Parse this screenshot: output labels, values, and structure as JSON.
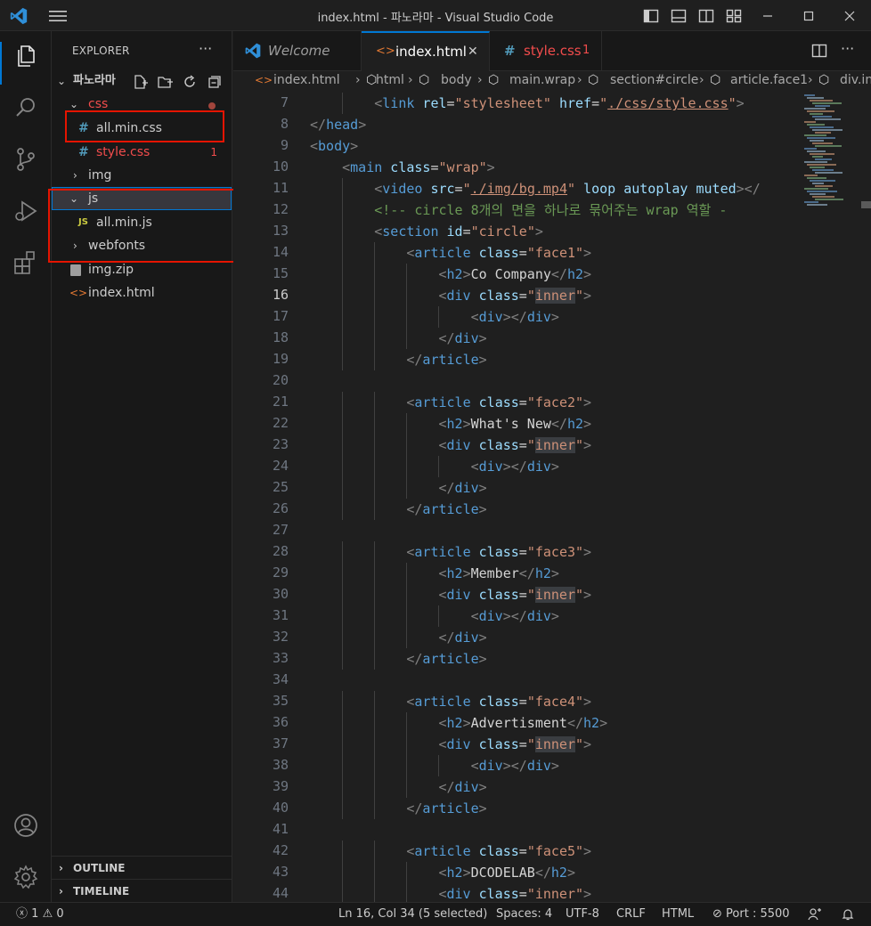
{
  "window": {
    "title": "index.html - 파노라마 - Visual Studio Code"
  },
  "explorer": {
    "header": "EXPLORER",
    "more": "···",
    "folder_name": "파노라마",
    "items": [
      {
        "label": "css",
        "type": "folder",
        "expanded": true,
        "color": "#f14c4c"
      },
      {
        "label": "all.min.css",
        "type": "css"
      },
      {
        "label": "style.css",
        "type": "css",
        "badge": "1",
        "color": "#f14c4c"
      },
      {
        "label": "img",
        "type": "folder",
        "expanded": false
      },
      {
        "label": "js",
        "type": "folder",
        "expanded": true
      },
      {
        "label": "all.min.js",
        "type": "js"
      },
      {
        "label": "webfonts",
        "type": "folder",
        "expanded": false
      },
      {
        "label": "img.zip",
        "type": "zip"
      },
      {
        "label": "index.html",
        "type": "html"
      }
    ],
    "outline": "OUTLINE",
    "timeline": "TIMELINE"
  },
  "tabs": [
    {
      "label": "Welcome",
      "italic": true
    },
    {
      "label": "index.html",
      "active": true,
      "close": "✕"
    },
    {
      "label": "style.css",
      "badge": "1",
      "color": "#f14c4c"
    }
  ],
  "breadcrumb": [
    "index.html",
    "html",
    "body",
    "main.wrap",
    "section#circle",
    "article.face1",
    "div.in"
  ],
  "editor": {
    "first_line": 7,
    "current_line": 16,
    "lines": [
      [
        [
          8,
          "<",
          "tagp"
        ],
        [
          0,
          "link",
          "tn"
        ],
        [
          0,
          " ",
          "tx"
        ],
        [
          0,
          "rel",
          "an"
        ],
        [
          0,
          "=",
          "tx"
        ],
        [
          0,
          "\"stylesheet\"",
          "av"
        ],
        [
          0,
          " ",
          "tx"
        ],
        [
          0,
          "href",
          "an"
        ],
        [
          0,
          "=",
          "tx"
        ],
        [
          0,
          "\"",
          "av"
        ],
        [
          0,
          "./css/style.css",
          "avu"
        ],
        [
          0,
          "\"",
          "av"
        ],
        [
          0,
          ">",
          "tagp"
        ]
      ],
      [
        [
          0,
          "</",
          "tagp"
        ],
        [
          0,
          "head",
          "tn"
        ],
        [
          0,
          ">",
          "tagp"
        ]
      ],
      [
        [
          0,
          "<",
          "tagp"
        ],
        [
          0,
          "body",
          "tn"
        ],
        [
          0,
          ">",
          "tagp"
        ]
      ],
      [
        [
          4,
          "<",
          "tagp"
        ],
        [
          0,
          "main",
          "tn"
        ],
        [
          0,
          " ",
          "tx"
        ],
        [
          0,
          "class",
          "an"
        ],
        [
          0,
          "=",
          "tx"
        ],
        [
          0,
          "\"wrap\"",
          "av"
        ],
        [
          0,
          ">",
          "tagp"
        ]
      ],
      [
        [
          8,
          "<",
          "tagp"
        ],
        [
          0,
          "video",
          "tn"
        ],
        [
          0,
          " ",
          "tx"
        ],
        [
          0,
          "src",
          "an"
        ],
        [
          0,
          "=",
          "tx"
        ],
        [
          0,
          "\"",
          "av"
        ],
        [
          0,
          "./img/bg.mp4",
          "avu"
        ],
        [
          0,
          "\"",
          "av"
        ],
        [
          0,
          " ",
          "tx"
        ],
        [
          0,
          "loop",
          "an"
        ],
        [
          0,
          " ",
          "tx"
        ],
        [
          0,
          "autoplay",
          "an"
        ],
        [
          0,
          " ",
          "tx"
        ],
        [
          0,
          "muted",
          "an"
        ],
        [
          0,
          "></",
          "tagp"
        ]
      ],
      [
        [
          8,
          "<!-- circle 8개의 면을 하나로 묶어주는 wrap 역할 -",
          "cm"
        ]
      ],
      [
        [
          8,
          "<",
          "tagp"
        ],
        [
          0,
          "section",
          "tn"
        ],
        [
          0,
          " ",
          "tx"
        ],
        [
          0,
          "id",
          "an"
        ],
        [
          0,
          "=",
          "tx"
        ],
        [
          0,
          "\"circle\"",
          "av"
        ],
        [
          0,
          ">",
          "tagp"
        ]
      ],
      [
        [
          12,
          "<",
          "tagp"
        ],
        [
          0,
          "article",
          "tn"
        ],
        [
          0,
          " ",
          "tx"
        ],
        [
          0,
          "class",
          "an"
        ],
        [
          0,
          "=",
          "tx"
        ],
        [
          0,
          "\"face1\"",
          "av"
        ],
        [
          0,
          ">",
          "tagp"
        ]
      ],
      [
        [
          16,
          "<",
          "tagp"
        ],
        [
          0,
          "h2",
          "tn"
        ],
        [
          0,
          ">",
          "tagp"
        ],
        [
          0,
          "Co Company",
          "tx"
        ],
        [
          0,
          "</",
          "tagp"
        ],
        [
          0,
          "h2",
          "tn"
        ],
        [
          0,
          ">",
          "tagp"
        ]
      ],
      [
        [
          16,
          "<",
          "tagp"
        ],
        [
          0,
          "div",
          "tn"
        ],
        [
          0,
          " ",
          "tx"
        ],
        [
          0,
          "class",
          "an"
        ],
        [
          0,
          "=",
          "tx"
        ],
        [
          0,
          "\"",
          "av"
        ],
        [
          0,
          "inner",
          "av hl"
        ],
        [
          0,
          "\"",
          "av"
        ],
        [
          0,
          ">",
          "tagp"
        ]
      ],
      [
        [
          20,
          "<",
          "tagp"
        ],
        [
          0,
          "div",
          "tn"
        ],
        [
          0,
          "></",
          "tagp"
        ],
        [
          0,
          "div",
          "tn"
        ],
        [
          0,
          ">",
          "tagp"
        ]
      ],
      [
        [
          16,
          "</",
          "tagp"
        ],
        [
          0,
          "div",
          "tn"
        ],
        [
          0,
          ">",
          "tagp"
        ]
      ],
      [
        [
          12,
          "</",
          "tagp"
        ],
        [
          0,
          "article",
          "tn"
        ],
        [
          0,
          ">",
          "tagp"
        ]
      ],
      [],
      [
        [
          12,
          "<",
          "tagp"
        ],
        [
          0,
          "article",
          "tn"
        ],
        [
          0,
          " ",
          "tx"
        ],
        [
          0,
          "class",
          "an"
        ],
        [
          0,
          "=",
          "tx"
        ],
        [
          0,
          "\"face2\"",
          "av"
        ],
        [
          0,
          ">",
          "tagp"
        ]
      ],
      [
        [
          16,
          "<",
          "tagp"
        ],
        [
          0,
          "h2",
          "tn"
        ],
        [
          0,
          ">",
          "tagp"
        ],
        [
          0,
          "What's New",
          "tx"
        ],
        [
          0,
          "</",
          "tagp"
        ],
        [
          0,
          "h2",
          "tn"
        ],
        [
          0,
          ">",
          "tagp"
        ]
      ],
      [
        [
          16,
          "<",
          "tagp"
        ],
        [
          0,
          "div",
          "tn"
        ],
        [
          0,
          " ",
          "tx"
        ],
        [
          0,
          "class",
          "an"
        ],
        [
          0,
          "=",
          "tx"
        ],
        [
          0,
          "\"",
          "av"
        ],
        [
          0,
          "inner",
          "av hl"
        ],
        [
          0,
          "\"",
          "av"
        ],
        [
          0,
          ">",
          "tagp"
        ]
      ],
      [
        [
          20,
          "<",
          "tagp"
        ],
        [
          0,
          "div",
          "tn"
        ],
        [
          0,
          "></",
          "tagp"
        ],
        [
          0,
          "div",
          "tn"
        ],
        [
          0,
          ">",
          "tagp"
        ]
      ],
      [
        [
          16,
          "</",
          "tagp"
        ],
        [
          0,
          "div",
          "tn"
        ],
        [
          0,
          ">",
          "tagp"
        ]
      ],
      [
        [
          12,
          "</",
          "tagp"
        ],
        [
          0,
          "article",
          "tn"
        ],
        [
          0,
          ">",
          "tagp"
        ]
      ],
      [],
      [
        [
          12,
          "<",
          "tagp"
        ],
        [
          0,
          "article",
          "tn"
        ],
        [
          0,
          " ",
          "tx"
        ],
        [
          0,
          "class",
          "an"
        ],
        [
          0,
          "=",
          "tx"
        ],
        [
          0,
          "\"face3\"",
          "av"
        ],
        [
          0,
          ">",
          "tagp"
        ]
      ],
      [
        [
          16,
          "<",
          "tagp"
        ],
        [
          0,
          "h2",
          "tn"
        ],
        [
          0,
          ">",
          "tagp"
        ],
        [
          0,
          "Member",
          "tx"
        ],
        [
          0,
          "</",
          "tagp"
        ],
        [
          0,
          "h2",
          "tn"
        ],
        [
          0,
          ">",
          "tagp"
        ]
      ],
      [
        [
          16,
          "<",
          "tagp"
        ],
        [
          0,
          "div",
          "tn"
        ],
        [
          0,
          " ",
          "tx"
        ],
        [
          0,
          "class",
          "an"
        ],
        [
          0,
          "=",
          "tx"
        ],
        [
          0,
          "\"",
          "av"
        ],
        [
          0,
          "inner",
          "av hl"
        ],
        [
          0,
          "\"",
          "av"
        ],
        [
          0,
          ">",
          "tagp"
        ]
      ],
      [
        [
          20,
          "<",
          "tagp"
        ],
        [
          0,
          "div",
          "tn"
        ],
        [
          0,
          "></",
          "tagp"
        ],
        [
          0,
          "div",
          "tn"
        ],
        [
          0,
          ">",
          "tagp"
        ]
      ],
      [
        [
          16,
          "</",
          "tagp"
        ],
        [
          0,
          "div",
          "tn"
        ],
        [
          0,
          ">",
          "tagp"
        ]
      ],
      [
        [
          12,
          "</",
          "tagp"
        ],
        [
          0,
          "article",
          "tn"
        ],
        [
          0,
          ">",
          "tagp"
        ]
      ],
      [],
      [
        [
          12,
          "<",
          "tagp"
        ],
        [
          0,
          "article",
          "tn"
        ],
        [
          0,
          " ",
          "tx"
        ],
        [
          0,
          "class",
          "an"
        ],
        [
          0,
          "=",
          "tx"
        ],
        [
          0,
          "\"face4\"",
          "av"
        ],
        [
          0,
          ">",
          "tagp"
        ]
      ],
      [
        [
          16,
          "<",
          "tagp"
        ],
        [
          0,
          "h2",
          "tn"
        ],
        [
          0,
          ">",
          "tagp"
        ],
        [
          0,
          "Advertisment",
          "tx"
        ],
        [
          0,
          "</",
          "tagp"
        ],
        [
          0,
          "h2",
          "tn"
        ],
        [
          0,
          ">",
          "tagp"
        ]
      ],
      [
        [
          16,
          "<",
          "tagp"
        ],
        [
          0,
          "div",
          "tn"
        ],
        [
          0,
          " ",
          "tx"
        ],
        [
          0,
          "class",
          "an"
        ],
        [
          0,
          "=",
          "tx"
        ],
        [
          0,
          "\"",
          "av"
        ],
        [
          0,
          "inner",
          "av hl"
        ],
        [
          0,
          "\"",
          "av"
        ],
        [
          0,
          ">",
          "tagp"
        ]
      ],
      [
        [
          20,
          "<",
          "tagp"
        ],
        [
          0,
          "div",
          "tn"
        ],
        [
          0,
          "></",
          "tagp"
        ],
        [
          0,
          "div",
          "tn"
        ],
        [
          0,
          ">",
          "tagp"
        ]
      ],
      [
        [
          16,
          "</",
          "tagp"
        ],
        [
          0,
          "div",
          "tn"
        ],
        [
          0,
          ">",
          "tagp"
        ]
      ],
      [
        [
          12,
          "</",
          "tagp"
        ],
        [
          0,
          "article",
          "tn"
        ],
        [
          0,
          ">",
          "tagp"
        ]
      ],
      [],
      [
        [
          12,
          "<",
          "tagp"
        ],
        [
          0,
          "article",
          "tn"
        ],
        [
          0,
          " ",
          "tx"
        ],
        [
          0,
          "class",
          "an"
        ],
        [
          0,
          "=",
          "tx"
        ],
        [
          0,
          "\"face5\"",
          "av"
        ],
        [
          0,
          ">",
          "tagp"
        ]
      ],
      [
        [
          16,
          "<",
          "tagp"
        ],
        [
          0,
          "h2",
          "tn"
        ],
        [
          0,
          ">",
          "tagp"
        ],
        [
          0,
          "DCODELAB",
          "tx"
        ],
        [
          0,
          "</",
          "tagp"
        ],
        [
          0,
          "h2",
          "tn"
        ],
        [
          0,
          ">",
          "tagp"
        ]
      ],
      [
        [
          16,
          "<",
          "tagp"
        ],
        [
          0,
          "div",
          "tn"
        ],
        [
          0,
          " ",
          "tx"
        ],
        [
          0,
          "class",
          "an"
        ],
        [
          0,
          "=",
          "tx"
        ],
        [
          0,
          "\"",
          "av"
        ],
        [
          0,
          "inner",
          "av"
        ],
        [
          0,
          "\"",
          "av"
        ],
        [
          0,
          ">",
          "tagp"
        ]
      ]
    ]
  },
  "status": {
    "errors": "1",
    "warnings": "0",
    "position": "Ln 16, Col 34 (5 selected)",
    "spaces": "Spaces: 4",
    "encoding": "UTF-8",
    "eol": "CRLF",
    "language": "HTML",
    "port": "Port : 5500"
  },
  "colors": {
    "accent": "#0078d4",
    "error": "#f14c4c",
    "highlight_box": "#e51400"
  }
}
